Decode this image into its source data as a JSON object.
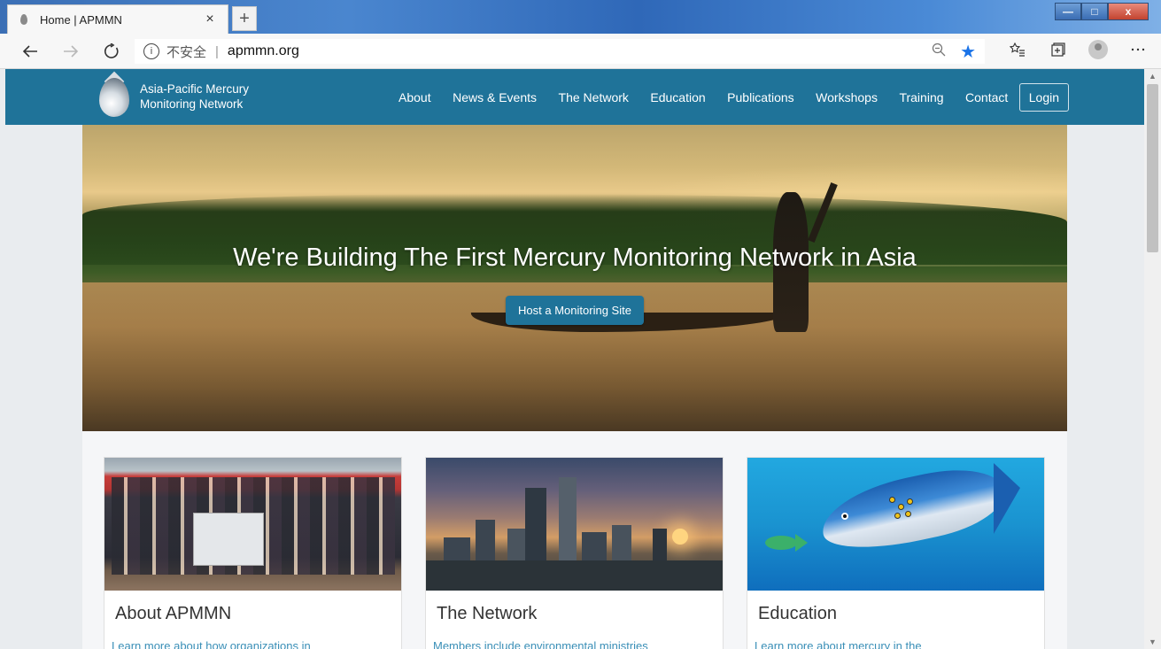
{
  "browser": {
    "tab_title": "Home | APMMN",
    "tab_close": "×",
    "new_tab": "+",
    "address": {
      "security_label": "不安全",
      "separator": "|",
      "url": "apmmn.org",
      "info_icon_glyph": "i"
    },
    "window_controls": {
      "minimize": "—",
      "maximize": "□",
      "close": "x"
    },
    "icons": [
      "back-icon",
      "forward-icon",
      "refresh-icon",
      "zoom-icon",
      "star-icon",
      "favorites-icon",
      "collections-icon",
      "profile-icon",
      "more-icon"
    ]
  },
  "site": {
    "brand_line1": "Asia-Pacific Mercury",
    "brand_line2": "Monitoring Network",
    "nav": [
      "About",
      "News & Events",
      "The Network",
      "Education",
      "Publications",
      "Workshops",
      "Training",
      "Contact"
    ],
    "login": "Login",
    "hero": {
      "title": "We're Building The First Mercury Monitoring Network in Asia",
      "button": "Host a Monitoring Site"
    },
    "cards": [
      {
        "title": "About APMMN",
        "text": "Learn more about how organizations in"
      },
      {
        "title": "The Network",
        "text": "Members include environmental ministries"
      },
      {
        "title": "Education",
        "text": "Learn more about mercury in the"
      }
    ]
  },
  "colors": {
    "nav_bg": "#1f7399",
    "button_bg": "#1f7399",
    "link": "#3a8fb7",
    "star": "#1a73e8"
  }
}
